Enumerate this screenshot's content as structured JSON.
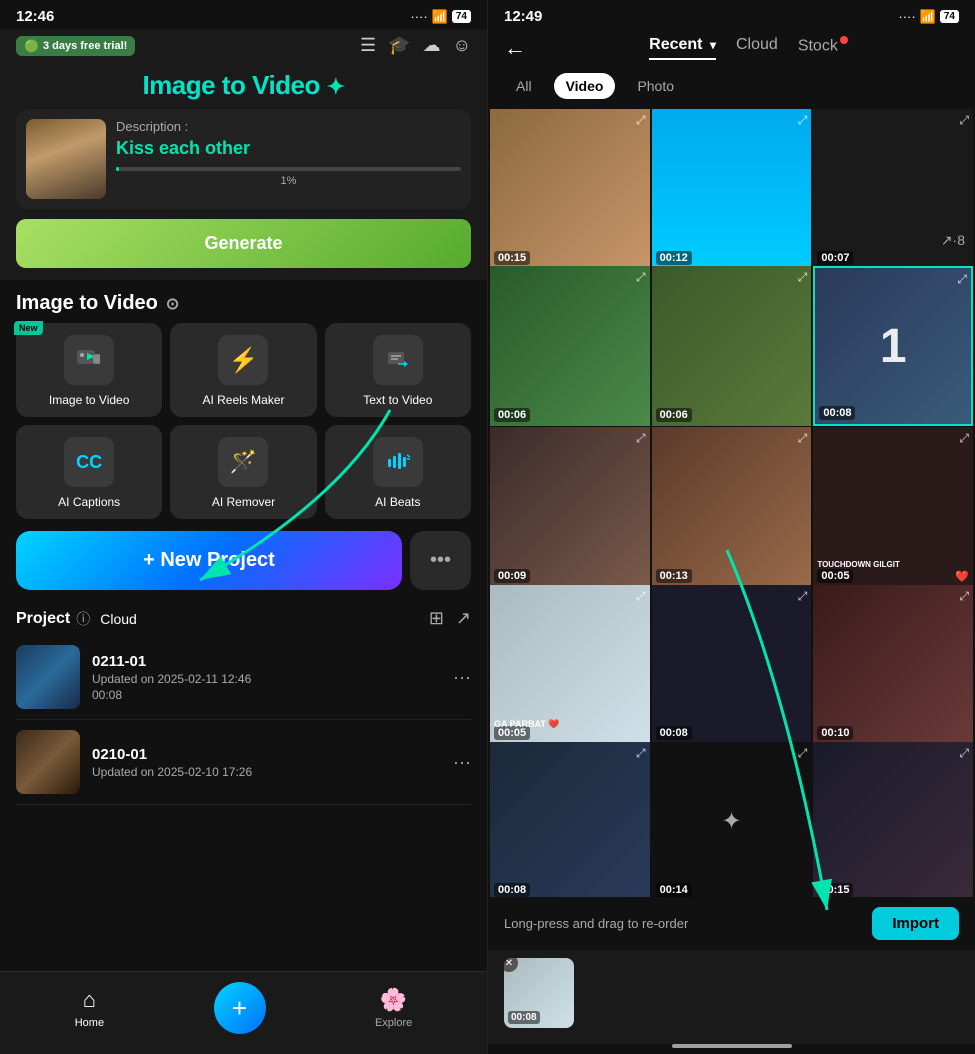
{
  "left": {
    "statusBar": {
      "time": "12:46",
      "emoji": "😊",
      "battery": "74"
    },
    "banner": {
      "trialText": "3 days free trial!",
      "trialIcon": "🟢"
    },
    "hero": {
      "title": "Image to Video",
      "titleSuffix": "✦",
      "descLabel": "Description :",
      "descValue": "Kiss each other",
      "progress": "1%",
      "generateLabel": "Generate"
    },
    "sectionTitle": "Image to Video",
    "tools": [
      {
        "id": "image-to-video",
        "label": "Image to Video",
        "icon": "🎬",
        "isNew": true
      },
      {
        "id": "ai-reels-maker",
        "label": "AI Reels Maker",
        "icon": "⚡",
        "isNew": false
      },
      {
        "id": "text-to-video",
        "label": "Text  to Video",
        "icon": "✏️",
        "isNew": false
      },
      {
        "id": "ai-captions",
        "label": "AI Captions",
        "icon": "CC",
        "isNew": false
      },
      {
        "id": "ai-remover",
        "label": "AI Remover",
        "icon": "🪄",
        "isNew": false
      },
      {
        "id": "ai-beats",
        "label": "AI Beats",
        "icon": "🎵",
        "isNew": false
      }
    ],
    "newProjectLabel": "+ New Project",
    "moreLabel": "•••",
    "projectSection": {
      "title": "Project",
      "cloudLabel": "Cloud",
      "projects": [
        {
          "id": "proj1",
          "name": "0211-01",
          "date": "Updated on 2025-02-11 12:46",
          "duration": "00:08"
        },
        {
          "id": "proj2",
          "name": "0210-01",
          "date": "Updated on 2025-02-10 17:26",
          "duration": ""
        }
      ]
    },
    "bottomNav": {
      "items": [
        {
          "id": "home",
          "label": "Home",
          "icon": "⌂",
          "active": true
        },
        {
          "id": "explore",
          "label": "Explore",
          "icon": "🌸",
          "active": false
        }
      ],
      "plusLabel": "+"
    }
  },
  "right": {
    "statusBar": {
      "time": "12:49",
      "emoji": "😊",
      "battery": "74"
    },
    "nav": {
      "backLabel": "←",
      "tabs": [
        {
          "id": "recent",
          "label": "Recent",
          "hasDropdown": true,
          "active": true
        },
        {
          "id": "cloud",
          "label": "Cloud",
          "hasDropdown": false,
          "active": false
        },
        {
          "id": "stock",
          "label": "Stock",
          "hasDropdown": false,
          "active": false,
          "hasDot": true
        }
      ]
    },
    "filters": [
      {
        "id": "all",
        "label": "All",
        "active": false
      },
      {
        "id": "video",
        "label": "Video",
        "active": true
      },
      {
        "id": "photo",
        "label": "Photo",
        "active": false
      }
    ],
    "videos": [
      {
        "id": "v1",
        "duration": "00:15",
        "class": "vt-1"
      },
      {
        "id": "v2",
        "duration": "00:12",
        "class": "vt-2"
      },
      {
        "id": "v3",
        "duration": "00:07",
        "class": "vt-3"
      },
      {
        "id": "v4",
        "duration": "00:06",
        "class": "vt-4"
      },
      {
        "id": "v5",
        "duration": "00:06",
        "class": "vt-5"
      },
      {
        "id": "v6",
        "duration": "00:08",
        "class": "vt-6",
        "hasNumber": "1",
        "selected": true
      },
      {
        "id": "v7",
        "duration": "00:09",
        "class": "vt-7"
      },
      {
        "id": "v8",
        "duration": "00:13",
        "class": "vt-8"
      },
      {
        "id": "v9",
        "duration": "00:05",
        "class": "vt-9",
        "text": "TOUCHDOWN GILGIT",
        "heart": "❤️"
      },
      {
        "id": "v10",
        "duration": "00:05",
        "class": "vt-10",
        "text": "GA PARBAT ❤️"
      },
      {
        "id": "v11",
        "duration": "00:08",
        "class": "vt-11"
      },
      {
        "id": "v12",
        "duration": "00:10",
        "class": "vt-12"
      },
      {
        "id": "v13",
        "duration": "00:08",
        "class": "vt-13"
      },
      {
        "id": "v14",
        "duration": "00:14",
        "class": "vt-14"
      },
      {
        "id": "v15",
        "duration": "00:15",
        "class": "vt-15"
      }
    ],
    "bottomBar": {
      "dragHint": "Long-press and drag to re-order",
      "importLabel": "Import"
    },
    "previewStrip": [
      {
        "id": "prev1",
        "duration": "00:08",
        "class": "vt-10"
      }
    ]
  }
}
